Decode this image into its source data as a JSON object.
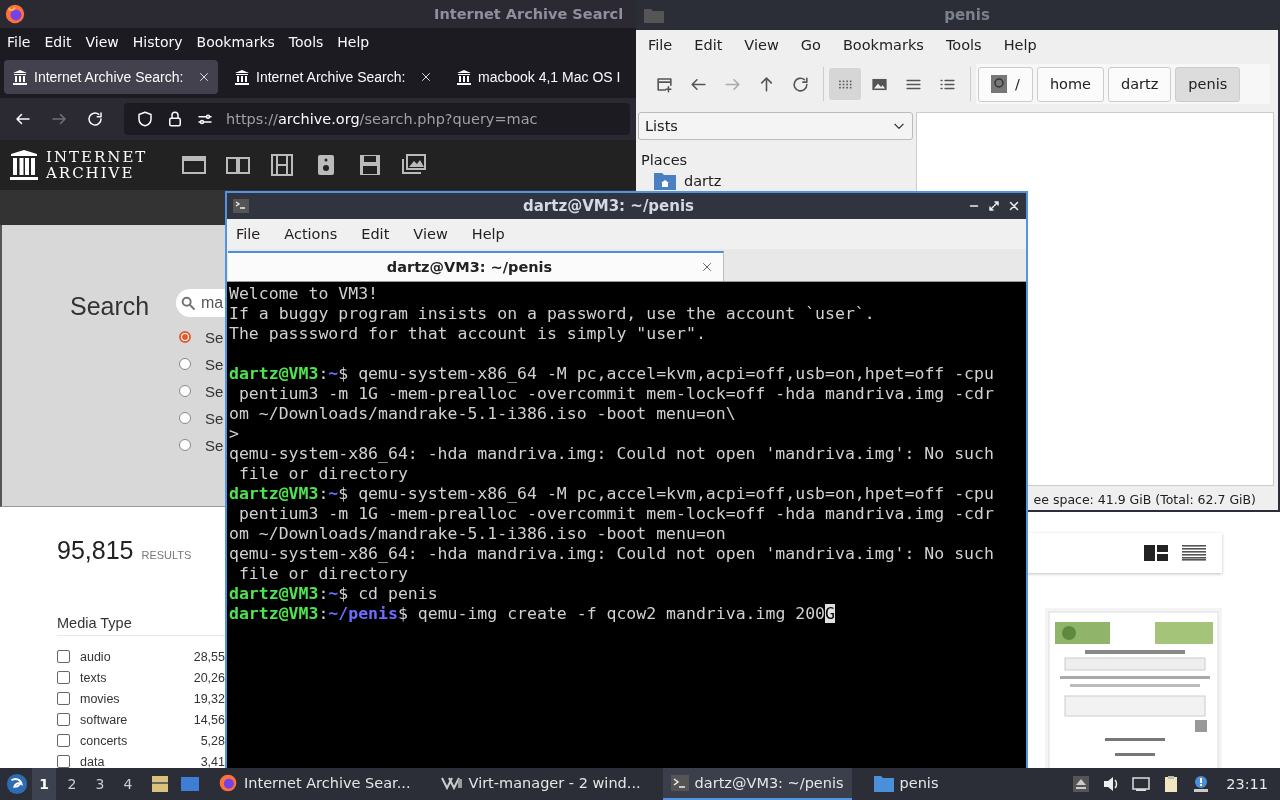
{
  "browser": {
    "title": "Internet Archive Searcl",
    "menu": [
      "File",
      "Edit",
      "View",
      "History",
      "Bookmarks",
      "Tools",
      "Help"
    ],
    "tabs": [
      {
        "label": "Internet Archive Search:",
        "selected": true
      },
      {
        "label": "Internet Archive Search:",
        "selected": false
      },
      {
        "label": "macbook 4,1 Mac OS I",
        "selected": false
      }
    ],
    "nav": [
      {
        "kind": "back",
        "disabled": false
      },
      {
        "kind": "forward",
        "disabled": true
      },
      {
        "kind": "reload",
        "disabled": false
      }
    ],
    "url": [
      {
        "text": "https://",
        "kind": "dim"
      },
      {
        "text": "archive.org",
        "kind": "host"
      },
      {
        "text": "/search.php?query=mac",
        "kind": "dim"
      }
    ],
    "logo": [
      "INTERNET",
      "ARCHIVE"
    ],
    "search": {
      "label": "Search",
      "value": "ma",
      "options": [
        {
          "label": "Se",
          "selected": true
        },
        {
          "label": "Se",
          "selected": false
        },
        {
          "label": "Se",
          "selected": false
        },
        {
          "label": "Se",
          "selected": false
        },
        {
          "label": "Se",
          "selected": false
        }
      ]
    },
    "results": {
      "count": "95,815",
      "unit": "RESULTS"
    },
    "facet": {
      "title": "Media Type",
      "items": [
        {
          "label": "audio",
          "count": "28,55",
          "checked": false
        },
        {
          "label": "texts",
          "count": "20,26",
          "checked": false
        },
        {
          "label": "movies",
          "count": "19,32",
          "checked": false
        },
        {
          "label": "software",
          "count": "14,56",
          "checked": false
        },
        {
          "label": "concerts",
          "count": "5,28",
          "checked": false
        },
        {
          "label": "data",
          "count": "3,41",
          "checked": false
        }
      ]
    },
    "views": [
      {
        "kind": "tiles",
        "selected": true
      },
      {
        "kind": "list",
        "selected": false
      }
    ],
    "thumbnail": {
      "kind": "picture"
    }
  },
  "file_manager": {
    "title": "penis",
    "menu": [
      "File",
      "Edit",
      "View",
      "Go",
      "Bookmarks",
      "Tools",
      "Help"
    ],
    "tools": [
      {
        "kind": "new-window",
        "disabled": false
      },
      {
        "kind": "back",
        "disabled": false
      },
      {
        "kind": "forward",
        "disabled": true
      },
      {
        "kind": "up",
        "disabled": false
      },
      {
        "kind": "reload",
        "disabled": false
      }
    ],
    "view_modes": [
      {
        "kind": "icons",
        "selected": true
      },
      {
        "kind": "thumbnails",
        "selected": false
      },
      {
        "kind": "compact",
        "selected": false
      },
      {
        "kind": "details",
        "selected": false
      }
    ],
    "path": [
      {
        "label": "/",
        "kind": "root",
        "selected": false
      },
      {
        "label": "home",
        "kind": "dir",
        "selected": false
      },
      {
        "label": "dartz",
        "kind": "dir",
        "selected": false
      },
      {
        "label": "penis",
        "kind": "dir",
        "selected": true
      }
    ],
    "side_select": "Lists",
    "places_title": "Places",
    "places": [
      {
        "label": "dartz"
      }
    ],
    "status": "ee space: 41.9 GiB (Total: 62.7 GiB)"
  },
  "terminal": {
    "title": "dartz@VM3: ~/penis",
    "menu": [
      "File",
      "Actions",
      "Edit",
      "View",
      "Help"
    ],
    "tab": "dartz@VM3: ~/penis",
    "lines": [
      {
        "kind": "text",
        "segments": [
          {
            "text": "Welcome to VM3!",
            "kind": "plain"
          }
        ]
      },
      {
        "kind": "text",
        "segments": [
          {
            "text": "If a buggy program insists on a password, use the account `user`.",
            "kind": "plain"
          }
        ]
      },
      {
        "kind": "text",
        "segments": [
          {
            "text": "The passsword for that account is simply \"user\".",
            "kind": "plain"
          }
        ]
      },
      {
        "kind": "blank"
      },
      {
        "kind": "text",
        "segments": [
          {
            "text": "dartz@VM3",
            "kind": "user"
          },
          {
            "text": ":",
            "kind": "plain"
          },
          {
            "text": "~",
            "kind": "path"
          },
          {
            "text": "$ qemu-system-x86_64 -M pc,accel=kvm,acpi=off,usb=on,hpet=off -cpu",
            "kind": "plain"
          }
        ]
      },
      {
        "kind": "text",
        "segments": [
          {
            "text": " pentium3 -m 1G -mem-prealloc -overcommit mem-lock=off -hda mandriva.img -cdr",
            "kind": "plain"
          }
        ]
      },
      {
        "kind": "text",
        "segments": [
          {
            "text": "om ~/Downloads/mandrake-5.1-i386.iso -boot menu=on\\",
            "kind": "plain"
          }
        ]
      },
      {
        "kind": "text",
        "segments": [
          {
            "text": ">",
            "kind": "plain"
          }
        ]
      },
      {
        "kind": "text",
        "segments": [
          {
            "text": "qemu-system-x86_64: -hda mandriva.img: Could not open 'mandriva.img': No such",
            "kind": "plain"
          }
        ]
      },
      {
        "kind": "text",
        "segments": [
          {
            "text": " file or directory",
            "kind": "plain"
          }
        ]
      },
      {
        "kind": "text",
        "segments": [
          {
            "text": "dartz@VM3",
            "kind": "user"
          },
          {
            "text": ":",
            "kind": "plain"
          },
          {
            "text": "~",
            "kind": "path"
          },
          {
            "text": "$ qemu-system-x86_64 -M pc,accel=kvm,acpi=off,usb=on,hpet=off -cpu",
            "kind": "plain"
          }
        ]
      },
      {
        "kind": "text",
        "segments": [
          {
            "text": " pentium3 -m 1G -mem-prealloc -overcommit mem-lock=off -hda mandriva.img -cdr",
            "kind": "plain"
          }
        ]
      },
      {
        "kind": "text",
        "segments": [
          {
            "text": "om ~/Downloads/mandrake-5.1-i386.iso -boot menu=on",
            "kind": "plain"
          }
        ]
      },
      {
        "kind": "text",
        "segments": [
          {
            "text": "qemu-system-x86_64: -hda mandriva.img: Could not open 'mandriva.img': No such",
            "kind": "plain"
          }
        ]
      },
      {
        "kind": "text",
        "segments": [
          {
            "text": " file or directory",
            "kind": "plain"
          }
        ]
      },
      {
        "kind": "text",
        "segments": [
          {
            "text": "dartz@VM3",
            "kind": "user"
          },
          {
            "text": ":",
            "kind": "plain"
          },
          {
            "text": "~",
            "kind": "path"
          },
          {
            "text": "$ cd penis",
            "kind": "plain"
          }
        ]
      },
      {
        "kind": "text",
        "segments": [
          {
            "text": "dartz@VM3",
            "kind": "user"
          },
          {
            "text": ":",
            "kind": "plain"
          },
          {
            "text": "~/penis",
            "kind": "path"
          },
          {
            "text": "$ qemu-img create -f qcow2 mandriva.img 200",
            "kind": "plain"
          },
          {
            "text": "G",
            "kind": "cursor"
          }
        ]
      }
    ]
  },
  "taskbar": {
    "workspaces": [
      {
        "label": "1",
        "selected": true
      },
      {
        "label": "2",
        "selected": false
      },
      {
        "label": "3",
        "selected": false
      },
      {
        "label": "4",
        "selected": false
      }
    ],
    "tasks": [
      {
        "label": "Internet Archive Sear...",
        "kind": "browser",
        "selected": false
      },
      {
        "label": "Virt-manager - 2 wind...",
        "kind": "virt",
        "selected": false
      },
      {
        "label": "dartz@VM3: ~/penis",
        "kind": "terminal",
        "selected": true
      },
      {
        "label": "penis",
        "kind": "folder",
        "selected": false
      }
    ],
    "clock": "23:11"
  }
}
